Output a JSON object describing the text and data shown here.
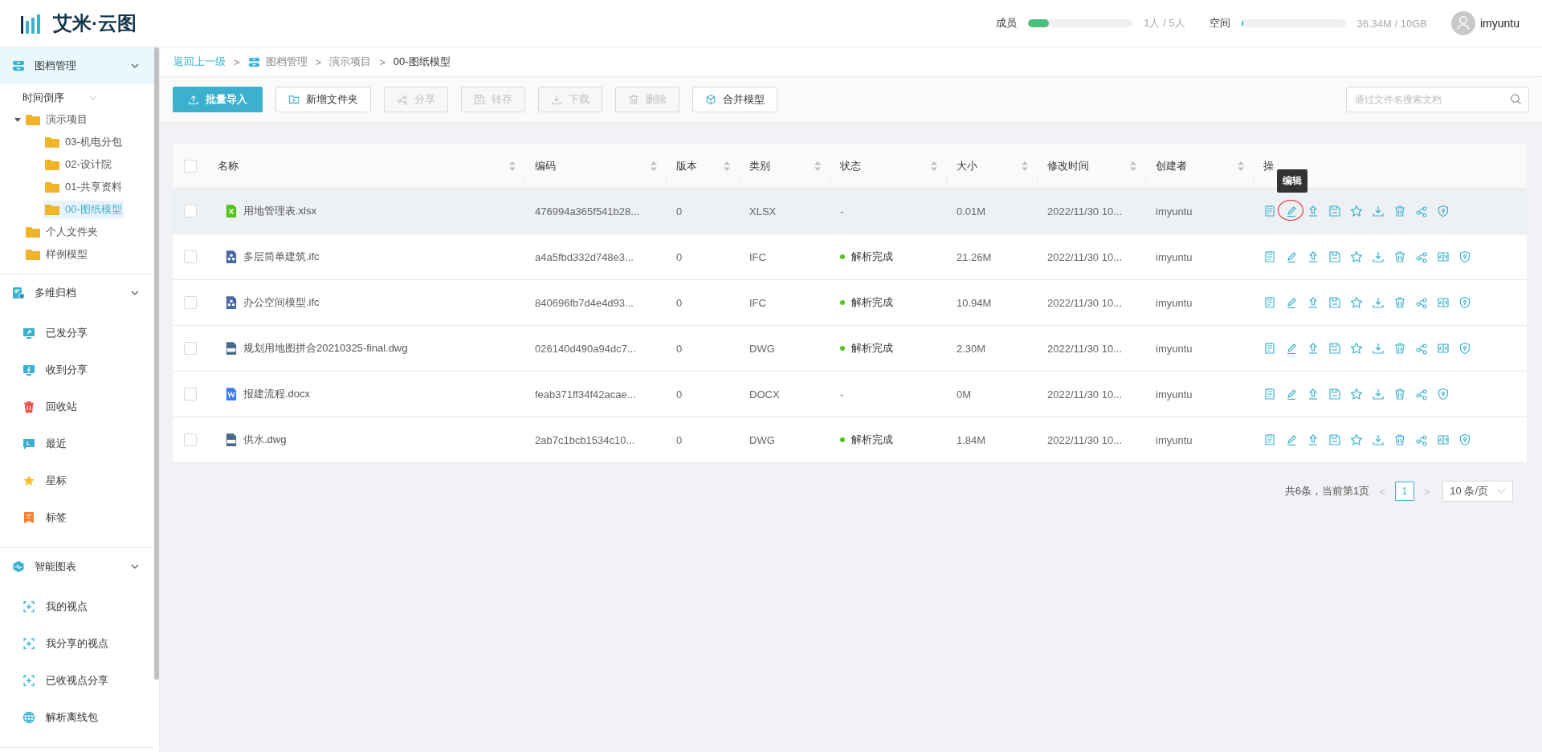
{
  "header": {
    "logo": "艾米·云图",
    "members": {
      "label": "成员",
      "level": 0.2,
      "reading": "1人 / 5人"
    },
    "space": {
      "label": "空间",
      "level": 0.006,
      "reading": "36.34M / 10GB"
    },
    "user": "imyuntu"
  },
  "sidebar": {
    "sections": [
      {
        "title": "图档管理",
        "kind": "archive",
        "active": true,
        "expanded": true,
        "sort": "时间倒序",
        "tree": [
          {
            "label": "演示项目",
            "expanded": true,
            "selected": false,
            "children": [
              {
                "label": "03-机电分包",
                "selected": false
              },
              {
                "label": "02-设计院",
                "selected": false
              },
              {
                "label": "01-共享资料",
                "selected": false
              },
              {
                "label": "00-图纸模型",
                "selected": true
              }
            ]
          },
          {
            "label": "个人文件夹",
            "selected": false
          },
          {
            "label": "样例模型",
            "selected": false
          }
        ]
      },
      {
        "title": "多维归档",
        "kind": "doc",
        "active": false,
        "expanded": true,
        "items": [
          {
            "label": "已发分享",
            "kind": "sent"
          },
          {
            "label": "收到分享",
            "kind": "received"
          },
          {
            "label": "回收站",
            "kind": "trash"
          },
          {
            "label": "最近",
            "kind": "recent"
          },
          {
            "label": "星标",
            "kind": "star"
          },
          {
            "label": "标签",
            "kind": "tag"
          }
        ]
      },
      {
        "title": "智能图表",
        "kind": "chart",
        "active": false,
        "expanded": true,
        "items": [
          {
            "label": "我的视点",
            "kind": "view"
          },
          {
            "label": "我分享的视点",
            "kind": "view"
          },
          {
            "label": "已收视点分享",
            "kind": "view"
          },
          {
            "label": "解析离线包",
            "kind": "globe"
          }
        ]
      }
    ]
  },
  "breadcrumb": {
    "back": "返回上一级",
    "separator": ">",
    "items": [
      {
        "label": "图档管理",
        "kind": "module",
        "current": false
      },
      {
        "label": "演示项目",
        "kind": "plain",
        "current": false
      },
      {
        "label": "00-图纸模型",
        "kind": "plain",
        "current": true
      }
    ]
  },
  "toolbar": {
    "buttons": [
      {
        "label": "批量导入",
        "kind": "upload",
        "primary": true,
        "disabled": false
      },
      {
        "label": "新增文件夹",
        "kind": "folder",
        "primary": false,
        "disabled": false
      },
      {
        "label": "分享",
        "kind": "share",
        "primary": false,
        "disabled": true
      },
      {
        "label": "转存",
        "kind": "save",
        "primary": false,
        "disabled": true
      },
      {
        "label": "下载",
        "kind": "download",
        "primary": false,
        "disabled": true
      },
      {
        "label": "删除",
        "kind": "delete",
        "primary": false,
        "disabled": true
      },
      {
        "label": "合并模型",
        "kind": "cube",
        "primary": false,
        "disabled": false
      }
    ],
    "search": {
      "placeholder": "通过文件名搜索文档"
    }
  },
  "table": {
    "select_all": false,
    "columns": [
      {
        "label": "名称",
        "sortable": true
      },
      {
        "label": "编码",
        "sortable": true
      },
      {
        "label": "版本",
        "sortable": true
      },
      {
        "label": "类别",
        "sortable": true
      },
      {
        "label": "状态",
        "sortable": true
      },
      {
        "label": "大小",
        "sortable": true
      },
      {
        "label": "修改时间",
        "sortable": true
      },
      {
        "label": "创建者",
        "sortable": true
      },
      {
        "label": "操",
        "sortable": false
      }
    ],
    "rows": [
      {
        "checked": false,
        "hovered": true,
        "kind": "excel",
        "name": "用地管理表.xlsx",
        "code": "476994a365f541b28...",
        "version": "0",
        "category": "XLSX",
        "status": "-",
        "status_dot": false,
        "size": "0.01M",
        "modified": "2022/11/30 10...",
        "creator": "imyuntu",
        "actions": [
          {
            "kind": "notes"
          },
          {
            "kind": "edit",
            "tooltip": "编辑",
            "circled": true
          },
          {
            "kind": "upload"
          },
          {
            "kind": "save"
          },
          {
            "kind": "star"
          },
          {
            "kind": "download"
          },
          {
            "kind": "delete"
          },
          {
            "kind": "share"
          },
          {
            "kind": "shield"
          }
        ]
      },
      {
        "checked": false,
        "hovered": false,
        "kind": "model",
        "name": "多层简单建筑.ifc",
        "code": "a4a5fbd332d748e3...",
        "version": "0",
        "category": "IFC",
        "status": "解析完成",
        "status_dot": true,
        "size": "21.26M",
        "modified": "2022/11/30 10...",
        "creator": "imyuntu",
        "actions": [
          {
            "kind": "notes"
          },
          {
            "kind": "edit"
          },
          {
            "kind": "upload"
          },
          {
            "kind": "save"
          },
          {
            "kind": "star"
          },
          {
            "kind": "download"
          },
          {
            "kind": "delete"
          },
          {
            "kind": "share"
          },
          {
            "kind": "convert"
          },
          {
            "kind": "shield"
          }
        ]
      },
      {
        "checked": false,
        "hovered": false,
        "kind": "model",
        "name": "办公空间模型.ifc",
        "code": "840696fb7d4e4d93...",
        "version": "0",
        "category": "IFC",
        "status": "解析完成",
        "status_dot": true,
        "size": "10.94M",
        "modified": "2022/11/30 10...",
        "creator": "imyuntu",
        "actions": [
          {
            "kind": "notes"
          },
          {
            "kind": "edit"
          },
          {
            "kind": "upload"
          },
          {
            "kind": "save"
          },
          {
            "kind": "star"
          },
          {
            "kind": "download"
          },
          {
            "kind": "delete"
          },
          {
            "kind": "share"
          },
          {
            "kind": "convert"
          },
          {
            "kind": "shield"
          }
        ]
      },
      {
        "checked": false,
        "hovered": false,
        "kind": "cad",
        "name": "规划用地图拼合20210325-final.dwg",
        "code": "026140d490a94dc7...",
        "version": "0",
        "category": "DWG",
        "status": "解析完成",
        "status_dot": true,
        "size": "2.30M",
        "modified": "2022/11/30 10...",
        "creator": "imyuntu",
        "actions": [
          {
            "kind": "notes"
          },
          {
            "kind": "edit"
          },
          {
            "kind": "upload"
          },
          {
            "kind": "save"
          },
          {
            "kind": "star"
          },
          {
            "kind": "download"
          },
          {
            "kind": "delete"
          },
          {
            "kind": "share"
          },
          {
            "kind": "convert"
          },
          {
            "kind": "shield"
          }
        ]
      },
      {
        "checked": false,
        "hovered": false,
        "kind": "word",
        "name": "报建流程.docx",
        "code": "feab371ff34f42acae...",
        "version": "0",
        "category": "DOCX",
        "status": "-",
        "status_dot": false,
        "size": "0M",
        "modified": "2022/11/30 10...",
        "creator": "imyuntu",
        "actions": [
          {
            "kind": "notes"
          },
          {
            "kind": "edit"
          },
          {
            "kind": "upload"
          },
          {
            "kind": "save"
          },
          {
            "kind": "star"
          },
          {
            "kind": "download"
          },
          {
            "kind": "delete"
          },
          {
            "kind": "share"
          },
          {
            "kind": "shield"
          }
        ]
      },
      {
        "checked": false,
        "hovered": false,
        "kind": "cad",
        "name": "供水.dwg",
        "code": "2ab7c1bcb1534c10...",
        "version": "0",
        "category": "DWG",
        "status": "解析完成",
        "status_dot": true,
        "size": "1.84M",
        "modified": "2022/11/30 10...",
        "creator": "imyuntu",
        "actions": [
          {
            "kind": "notes"
          },
          {
            "kind": "edit"
          },
          {
            "kind": "upload"
          },
          {
            "kind": "save"
          },
          {
            "kind": "star"
          },
          {
            "kind": "download"
          },
          {
            "kind": "delete"
          },
          {
            "kind": "share"
          },
          {
            "kind": "convert"
          },
          {
            "kind": "shield"
          }
        ]
      }
    ]
  },
  "pagination": {
    "summary": "共6条，当前第1页",
    "prev": "<",
    "next": ">",
    "pages": [
      {
        "label": "1",
        "selected": true
      }
    ],
    "page_size": "10 条/页"
  }
}
